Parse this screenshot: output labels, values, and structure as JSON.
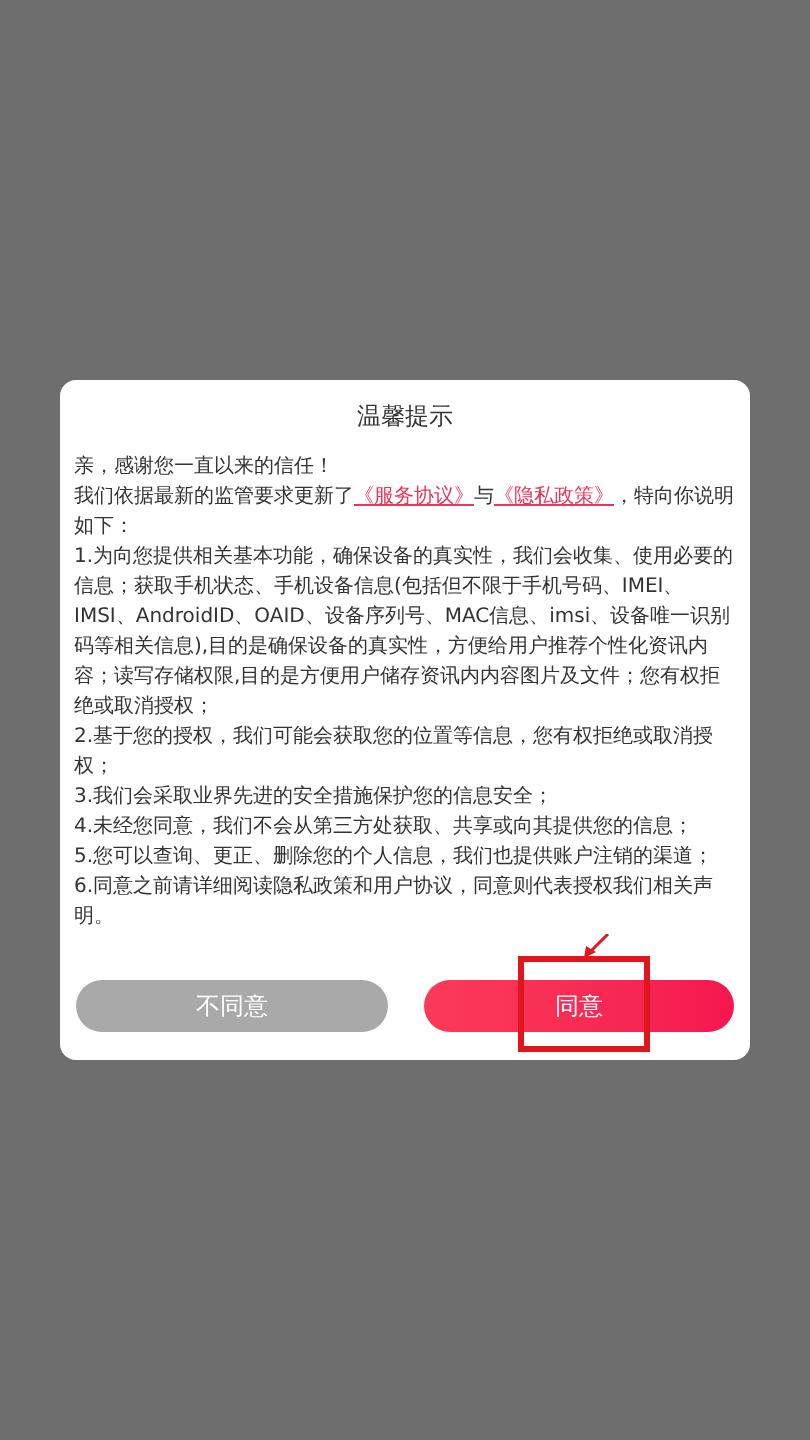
{
  "dialog": {
    "title": "温馨提示",
    "greeting": "亲，感谢您一直以来的信任！",
    "notice": [
      {
        "kind": "text",
        "text": "我们依据最新的监管要求更新了"
      },
      {
        "kind": "link",
        "text": "《服务协议》"
      },
      {
        "kind": "text",
        "text": "与"
      },
      {
        "kind": "link",
        "text": "《隐私政策》"
      },
      {
        "kind": "text",
        "text": "，特向你说明如下："
      }
    ],
    "items": [
      "1.为向您提供相关基本功能，确保设备的真实性，我们会收集、使用必要的信息；获取手机状态、手机设备信息(包括但不限于手机号码、IMEI、IMSI、AndroidID、OAID、设备序列号、MAC信息、imsi、设备唯一识别码等相关信息),目的是确保设备的真实性，方便给用户推荐个性化资讯内容；读写存储权限,目的是方便用户储存资讯内内容图片及文件；您有权拒绝或取消授权；",
      "2.基于您的授权，我们可能会获取您的位置等信息，您有权拒绝或取消授权；",
      "3.我们会采取业界先进的安全措施保护您的信息安全；",
      "4.未经您同意，我们不会从第三方处获取、共享或向其提供您的信息；",
      "5.您可以查询、更正、删除您的个人信息，我们也提供账户注销的渠道；",
      "6.同意之前请详细阅读隐私政策和用户协议，同意则代表授权我们相关声明。"
    ],
    "buttons": [
      {
        "label": "不同意",
        "kind": "decline"
      },
      {
        "label": "同意",
        "kind": "accept"
      }
    ]
  }
}
